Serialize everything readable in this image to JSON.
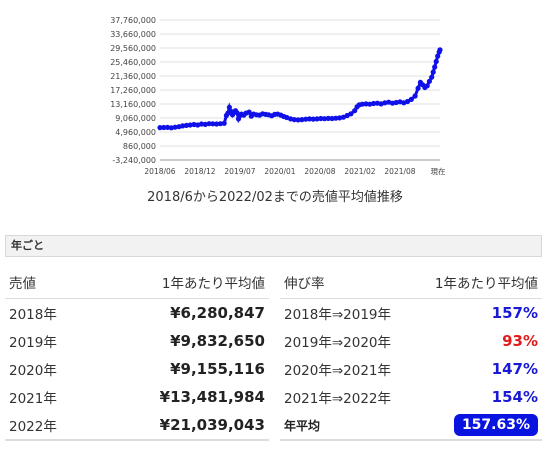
{
  "chart_data": {
    "type": "scatter",
    "y_ticks": [
      "37,760,000",
      "33,660,000",
      "29,560,000",
      "25,460,000",
      "21,360,000",
      "17,260,000",
      "13,160,000",
      "9,060,000",
      "4,960,000",
      "860,000",
      "-3,240,000"
    ],
    "x_ticks": [
      "2018/06",
      "2018/12",
      "2019/07",
      "2020/01",
      "2020/08",
      "2021/02",
      "2021/08",
      "現在"
    ],
    "ylim": [
      -3240000,
      37760000
    ],
    "xlim": [
      2018.42,
      2022.13
    ],
    "series_color": "#1010e8",
    "points": [
      [
        2018.42,
        6250000
      ],
      [
        2018.47,
        6280000
      ],
      [
        2018.52,
        6320000
      ],
      [
        2018.57,
        6200000
      ],
      [
        2018.62,
        6380000
      ],
      [
        2018.67,
        6500000
      ],
      [
        2018.72,
        6750000
      ],
      [
        2018.77,
        6900000
      ],
      [
        2018.82,
        7000000
      ],
      [
        2018.87,
        7150000
      ],
      [
        2018.92,
        7000000
      ],
      [
        2018.97,
        7300000
      ],
      [
        2019.02,
        7200000
      ],
      [
        2019.07,
        7400000
      ],
      [
        2019.12,
        7350000
      ],
      [
        2019.17,
        7300000
      ],
      [
        2019.22,
        7400000
      ],
      [
        2019.27,
        7500000
      ],
      [
        2019.3,
        9800000
      ],
      [
        2019.32,
        10500000
      ],
      [
        2019.34,
        12200000
      ],
      [
        2019.36,
        11000000
      ],
      [
        2019.38,
        10000000
      ],
      [
        2019.4,
        10800000
      ],
      [
        2019.42,
        11200000
      ],
      [
        2019.44,
        10600000
      ],
      [
        2019.46,
        8800000
      ],
      [
        2019.48,
        9800000
      ],
      [
        2019.5,
        10200000
      ],
      [
        2019.53,
        9900000
      ],
      [
        2019.56,
        10500000
      ],
      [
        2019.6,
        10800000
      ],
      [
        2019.63,
        9600000
      ],
      [
        2019.66,
        10200000
      ],
      [
        2019.7,
        10000000
      ],
      [
        2019.74,
        9900000
      ],
      [
        2019.78,
        10300000
      ],
      [
        2019.82,
        10100000
      ],
      [
        2019.86,
        10000000
      ],
      [
        2019.9,
        9700000
      ],
      [
        2019.94,
        10100000
      ],
      [
        2019.98,
        10200000
      ],
      [
        2020.02,
        9900000
      ],
      [
        2020.06,
        9500000
      ],
      [
        2020.1,
        9200000
      ],
      [
        2020.15,
        8800000
      ],
      [
        2020.2,
        8600000
      ],
      [
        2020.25,
        8500000
      ],
      [
        2020.3,
        8600000
      ],
      [
        2020.35,
        8700000
      ],
      [
        2020.4,
        8800000
      ],
      [
        2020.45,
        8750000
      ],
      [
        2020.5,
        8800000
      ],
      [
        2020.55,
        8900000
      ],
      [
        2020.6,
        8850000
      ],
      [
        2020.65,
        8950000
      ],
      [
        2020.7,
        8900000
      ],
      [
        2020.75,
        9000000
      ],
      [
        2020.8,
        9100000
      ],
      [
        2020.85,
        9300000
      ],
      [
        2020.9,
        9800000
      ],
      [
        2020.95,
        10300000
      ],
      [
        2021.0,
        11200000
      ],
      [
        2021.03,
        12300000
      ],
      [
        2021.06,
        12900000
      ],
      [
        2021.1,
        13100000
      ],
      [
        2021.15,
        13200000
      ],
      [
        2021.2,
        13100000
      ],
      [
        2021.25,
        13300000
      ],
      [
        2021.3,
        13400000
      ],
      [
        2021.35,
        13200000
      ],
      [
        2021.4,
        13500000
      ],
      [
        2021.45,
        13700000
      ],
      [
        2021.5,
        13400000
      ],
      [
        2021.55,
        13600000
      ],
      [
        2021.6,
        13800000
      ],
      [
        2021.65,
        13500000
      ],
      [
        2021.7,
        13900000
      ],
      [
        2021.75,
        14500000
      ],
      [
        2021.8,
        15500000
      ],
      [
        2021.84,
        17800000
      ],
      [
        2021.87,
        19500000
      ],
      [
        2021.9,
        18800000
      ],
      [
        2021.93,
        18000000
      ],
      [
        2021.96,
        18500000
      ],
      [
        2021.99,
        19800000
      ],
      [
        2022.02,
        21000000
      ],
      [
        2022.04,
        22500000
      ],
      [
        2022.06,
        24000000
      ],
      [
        2022.08,
        25600000
      ],
      [
        2022.1,
        27200000
      ],
      [
        2022.12,
        28400000
      ],
      [
        2022.13,
        29000000
      ]
    ]
  },
  "chart_caption": "2018/6から2022/02までの売値平均値推移",
  "section_title": "年ごと",
  "price_table": {
    "header": {
      "label": "売値",
      "value": "1年あたり平均値"
    },
    "rows": [
      {
        "year": "2018年",
        "value": "¥6,280,847"
      },
      {
        "year": "2019年",
        "value": "¥9,832,650"
      },
      {
        "year": "2020年",
        "value": "¥9,155,116"
      },
      {
        "year": "2021年",
        "value": "¥13,481,984"
      },
      {
        "year": "2022年",
        "value": "¥21,039,043"
      }
    ]
  },
  "growth_table": {
    "header": {
      "label": "伸び率",
      "value": "1年あたり平均値"
    },
    "rows": [
      {
        "period": "2018年⇒2019年",
        "rate": "157%",
        "trend": "up"
      },
      {
        "period": "2019年⇒2020年",
        "rate": "93%",
        "trend": "down"
      },
      {
        "period": "2020年⇒2021年",
        "rate": "147%",
        "trend": "up"
      },
      {
        "period": "2021年⇒2022年",
        "rate": "154%",
        "trend": "up"
      }
    ],
    "average": {
      "label": "年平均",
      "value": "157.63%"
    }
  }
}
